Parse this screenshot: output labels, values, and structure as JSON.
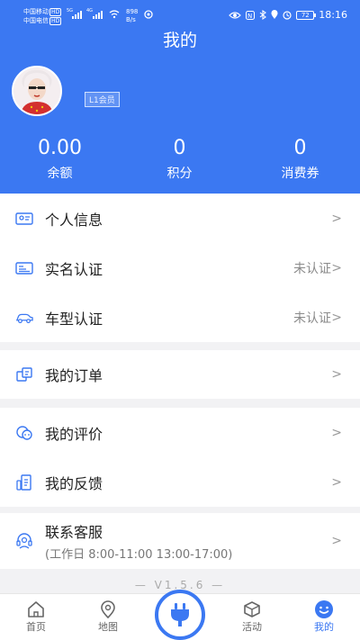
{
  "status_bar": {
    "carrier1": "中国移动",
    "carrier2": "中国电信",
    "hd": "HD",
    "net": "5G",
    "net2": "4G",
    "speed_value": "898",
    "speed_unit": "B/s",
    "battery": "72",
    "time": "18:16"
  },
  "header": {
    "title": "我的",
    "badge": "L1会员"
  },
  "stats": [
    {
      "value": "0.00",
      "label": "余额"
    },
    {
      "value": "0",
      "label": "积分"
    },
    {
      "value": "0",
      "label": "消费券"
    }
  ],
  "menu": {
    "profile": {
      "label": "个人信息",
      "icon": "id-card-icon"
    },
    "realname": {
      "label": "实名认证",
      "status": "未认证",
      "icon": "card-icon"
    },
    "vehicle": {
      "label": "车型认证",
      "status": "未认证",
      "icon": "car-icon"
    },
    "orders": {
      "label": "我的订单",
      "icon": "order-icon"
    },
    "reviews": {
      "label": "我的评价",
      "icon": "review-icon"
    },
    "feedback": {
      "label": "我的反馈",
      "icon": "feedback-icon"
    },
    "service": {
      "label": "联系客服",
      "hours": "(工作日 8:00-11:00 13:00-17:00)",
      "icon": "headset-icon"
    }
  },
  "chevron": ">",
  "version": "— V1.5.6 —",
  "tabs": [
    {
      "label": "首页",
      "icon": "home-icon"
    },
    {
      "label": "地图",
      "icon": "map-pin-icon"
    },
    {
      "label": "活动",
      "icon": "box-icon"
    },
    {
      "label": "我的",
      "icon": "smile-icon"
    }
  ],
  "colors": {
    "accent": "#3b78f2",
    "background": "#f2f2f4"
  }
}
